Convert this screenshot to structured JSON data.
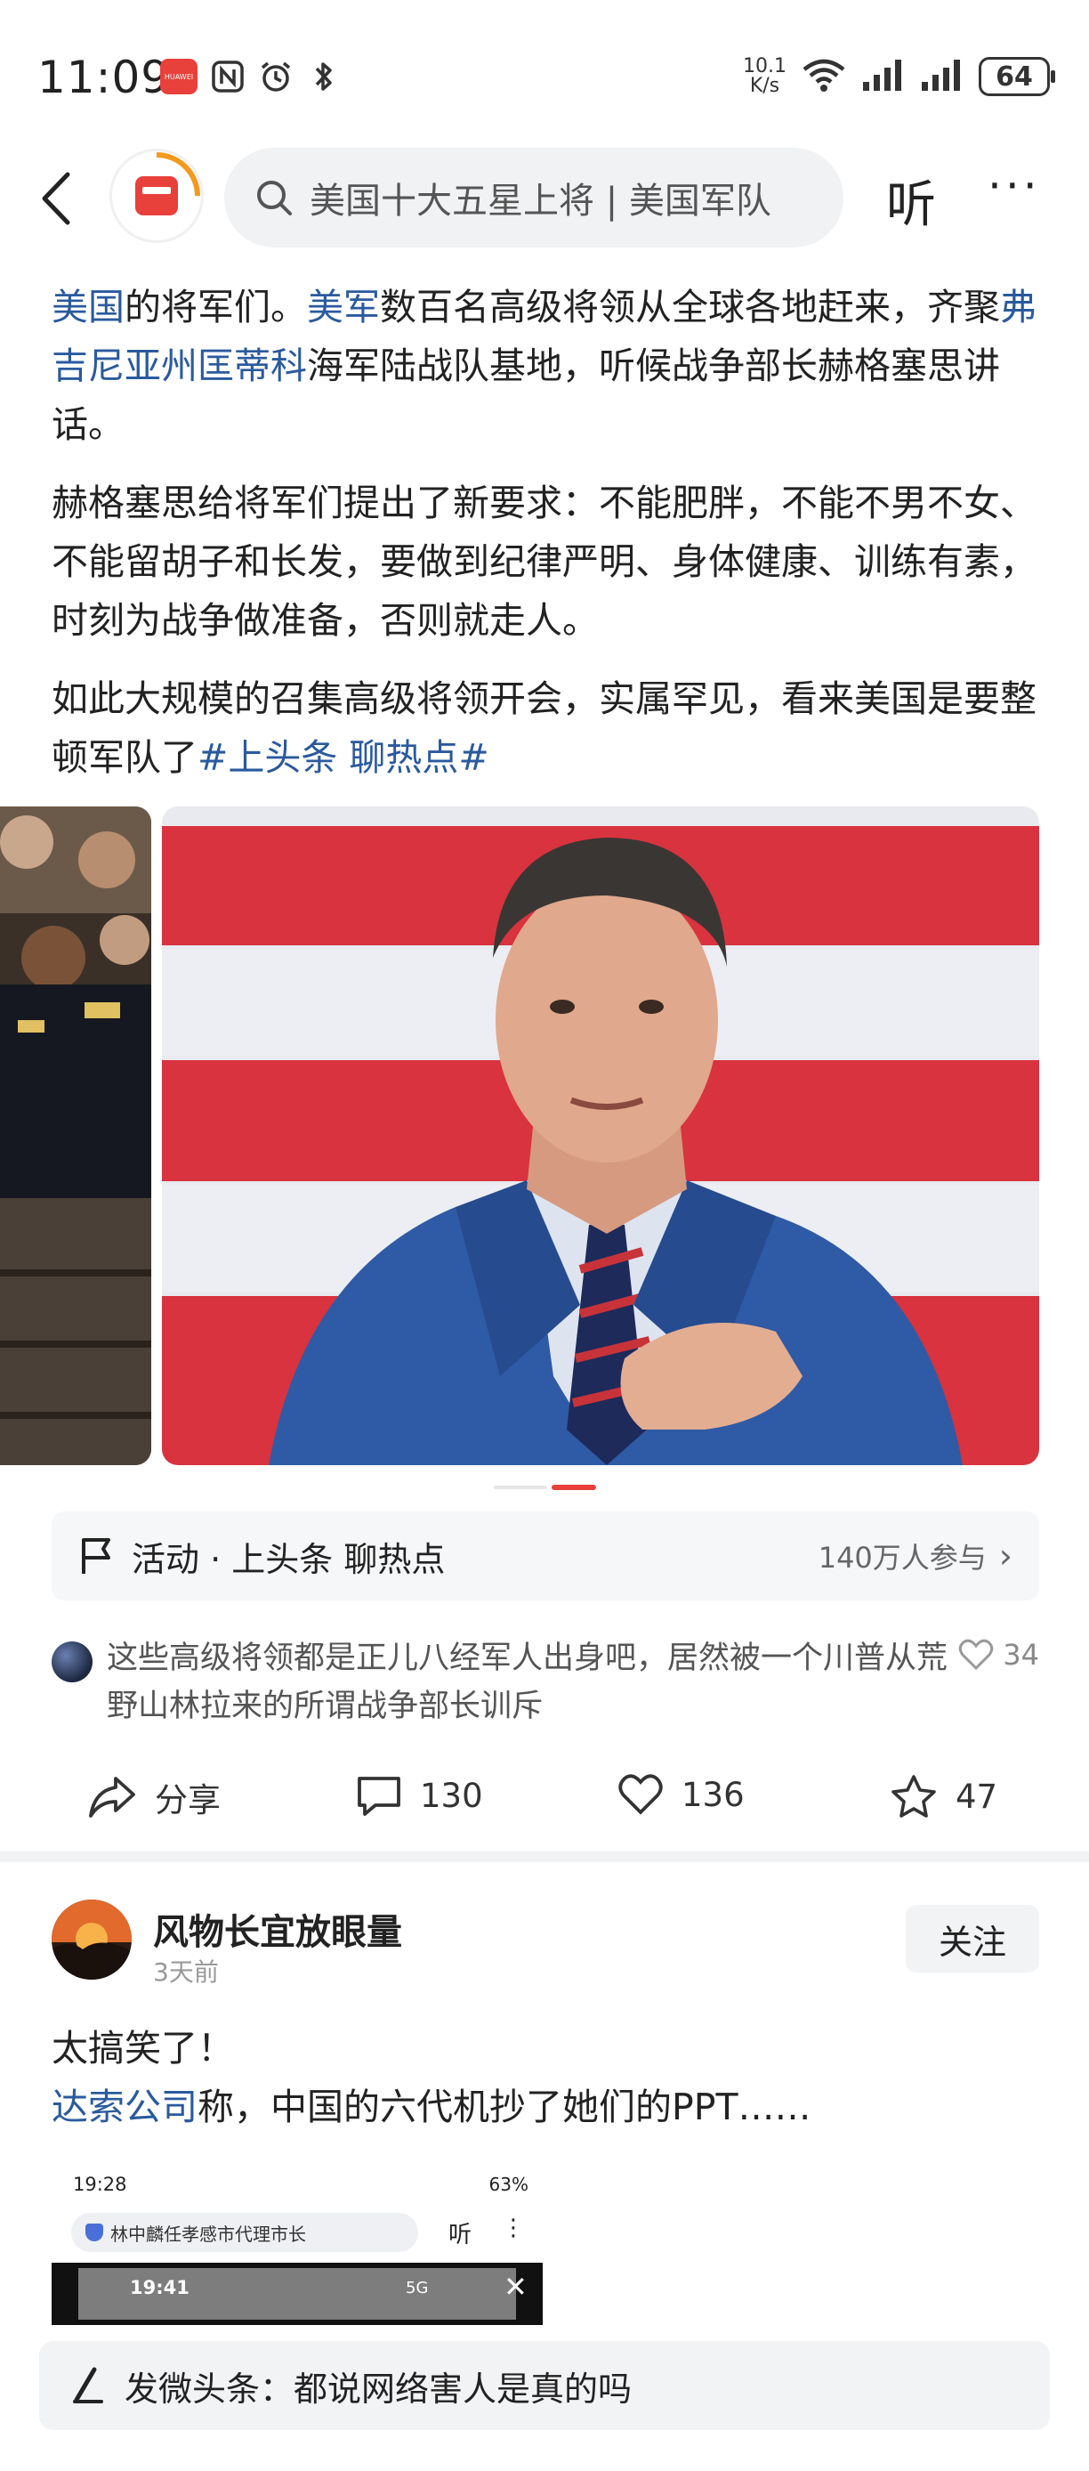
{
  "status_bar": {
    "time": "11:09",
    "net_speed_value": "10.1",
    "net_speed_unit": "K/s",
    "battery": "64",
    "brand_badge": "HUAWEI"
  },
  "nav": {
    "search_placeholder": "美国十大五星上将 | 美国军队",
    "listen_label": "听",
    "more_label": "···"
  },
  "article": {
    "p1": [
      {
        "t": "美国",
        "link": true
      },
      {
        "t": "的将军们。",
        "link": false
      },
      {
        "t": "美军",
        "link": true
      },
      {
        "t": "数百名高级将领从全球各地赶来，齐聚",
        "link": false
      },
      {
        "t": "弗吉尼亚州匡蒂科",
        "link": true
      },
      {
        "t": "海军陆战队基地，听候战争部长赫格塞思讲话。",
        "link": false
      }
    ],
    "p2": "赫格塞思给将军们提出了新要求：不能肥胖，不能不男不女、不能留胡子和长发，要做到纪律严明、身体健康、训练有素，时刻为战争做准备，否则就走人。",
    "p3_text": "如此大规模的召集高级将领开会，实属罕见，看来美国是要整顿军队了",
    "p3_tag": "#上头条 聊热点#"
  },
  "activity": {
    "label": "活动 · 上头条 聊热点",
    "count": "140万人参与"
  },
  "top_comment": {
    "text": "这些高级将领都是正儿八经军人出身吧，居然被一个川普从荒野山林拉来的所谓战争部长训斥",
    "likes": "34"
  },
  "actions": {
    "share": "分享",
    "comments": "130",
    "likes": "136",
    "favorites": "47"
  },
  "post2": {
    "author": "风物长宜放眼量",
    "time": "3天前",
    "follow": "关注",
    "line1": "太搞笑了！",
    "line2_link": "达索公司",
    "line2_text": "称，中国的六代机抄了她们的PPT……",
    "embed": {
      "time": "19:28",
      "status": "63%",
      "search": "林中麟任孝感市代理市长",
      "listen": "听",
      "more": "⋮",
      "inner_time": "19:41",
      "inner_status": "5G",
      "close": "✕"
    }
  },
  "compose": {
    "text": "发微头条：都说网络害人是真的吗"
  },
  "colors": {
    "link": "#2a5a9e",
    "accent_red": "#e8403a",
    "flag_red": "#d8333f"
  }
}
